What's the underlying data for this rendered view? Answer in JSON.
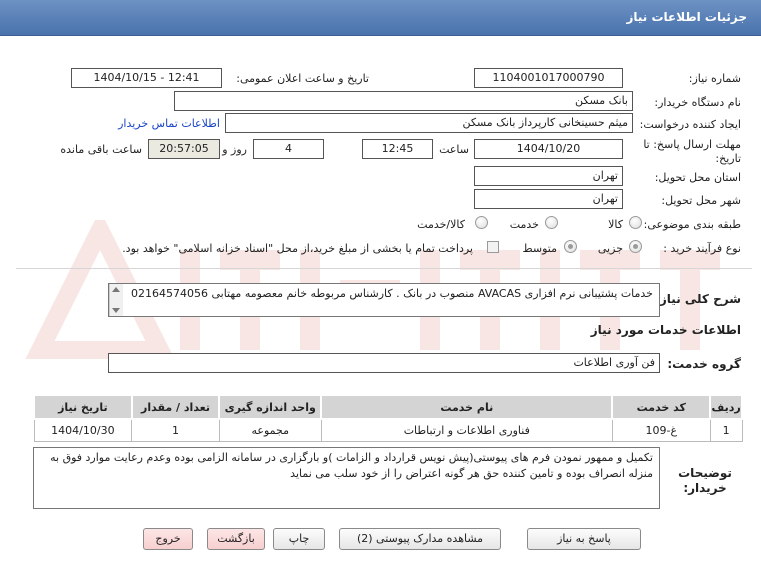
{
  "header": {
    "title": "جزئیات اطلاعات نیاز"
  },
  "form": {
    "need_number_label": "شماره نیاز:",
    "need_number": "1104001017000790",
    "announce_label": "تاریخ و ساعت اعلان عمومی:",
    "announce_value": "1404/10/15 - 12:41",
    "buyer_org_label": "نام دستگاه خریدار:",
    "buyer_org": "بانک مسکن",
    "creator_label": "ایجاد کننده درخواست:",
    "creator": "میثم حسینخانی کارپرداز بانک مسکن",
    "contact_link": "اطلاعات تماس خریدار",
    "deadline_label": "مهلت ارسال پاسخ: تا تاریخ:",
    "deadline_date": "1404/10/20",
    "time_label": "ساعت",
    "deadline_time": "12:45",
    "days_value": "4",
    "days_label": "روز و",
    "remaining_time": "20:57:05",
    "remaining_label": "ساعت باقی مانده",
    "province_label": "استان محل تحویل:",
    "province": "تهران",
    "city_label": "شهر محل تحویل:",
    "city": "تهران",
    "category_label": "طبقه بندی موضوعی:",
    "category_options": [
      "کالا",
      "خدمت",
      "کالا/خدمت"
    ],
    "process_label": "نوع فرآیند خرید :",
    "process_options": [
      "جزیی",
      "متوسط"
    ],
    "payment_note": "پرداخت تمام یا بخشی از مبلغ خرید،از محل \"اسناد خزانه اسلامی\" خواهد بود."
  },
  "description": {
    "label": "شرح کلی نیاز:",
    "text": "خدمات پشتیبانی نرم افزاری AVACAS منصوب در بانک . کارشناس مربوطه خانم معصومه مهتابی 02164574056"
  },
  "services": {
    "section_title": "اطلاعات خدمات مورد نیاز",
    "group_label": "گروه خدمت:",
    "group_value": "فن آوری اطلاعات",
    "columns": [
      "ردیف",
      "کد خدمت",
      "نام خدمت",
      "واحد اندازه گیری",
      "تعداد / مقدار",
      "تاریخ نیاز"
    ],
    "rows": [
      {
        "row": "1",
        "code": "غ-109",
        "name": "فناوری اطلاعات و ارتباطات",
        "unit": "مجموعه",
        "qty": "1",
        "date": "1404/10/30"
      }
    ]
  },
  "buyer_notes": {
    "label": "توضیحات خریدار:",
    "text": "تکمیل و ممهور نمودن فرم های پیوستی(پیش نویس قرارداد و الزامات )و بارگزاری در سامانه الزامی بوده وعدم رعایت موارد فوق به منزله انصراف بوده و تامین کننده حق هر گونه اعتراض را از خود سلب می نماید"
  },
  "buttons": {
    "reply": "پاسخ به نیاز",
    "attachments": "مشاهده مدارک پیوستی (2)",
    "print": "چاپ",
    "back": "بازگشت",
    "exit": "خروج"
  },
  "colors": {
    "header_bg": "#5a7fb8",
    "link": "#1a45c8",
    "watermark": "#c0392b"
  }
}
